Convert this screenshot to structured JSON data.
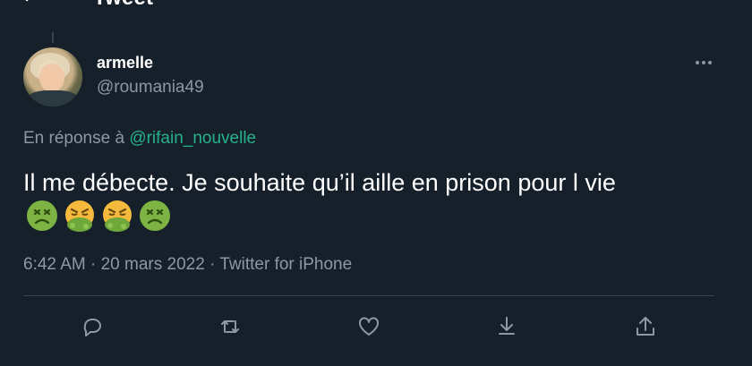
{
  "header": {
    "title": "Tweet"
  },
  "author": {
    "display_name": "armelle",
    "handle": "@roumania49"
  },
  "reply": {
    "prefix": "En réponse à ",
    "to": "@rifain_nouvelle"
  },
  "tweet": {
    "text": "Il me débecte. Je souhaite qu’il aille en prison pour l vie",
    "emojis": [
      "nauseated-face",
      "face-vomiting",
      "face-vomiting",
      "nauseated-face"
    ]
  },
  "meta": {
    "time": "6:42 AM",
    "sep1": " · ",
    "date": "20 mars 2022",
    "sep2": " · ",
    "source": "Twitter for iPhone"
  },
  "colors": {
    "background": "#15202b",
    "muted": "#8b98a5",
    "accent": "#26b38a",
    "divider": "#38444d"
  },
  "actions": [
    "reply-icon",
    "retweet-icon",
    "like-icon",
    "bookmark-icon",
    "share-icon"
  ]
}
